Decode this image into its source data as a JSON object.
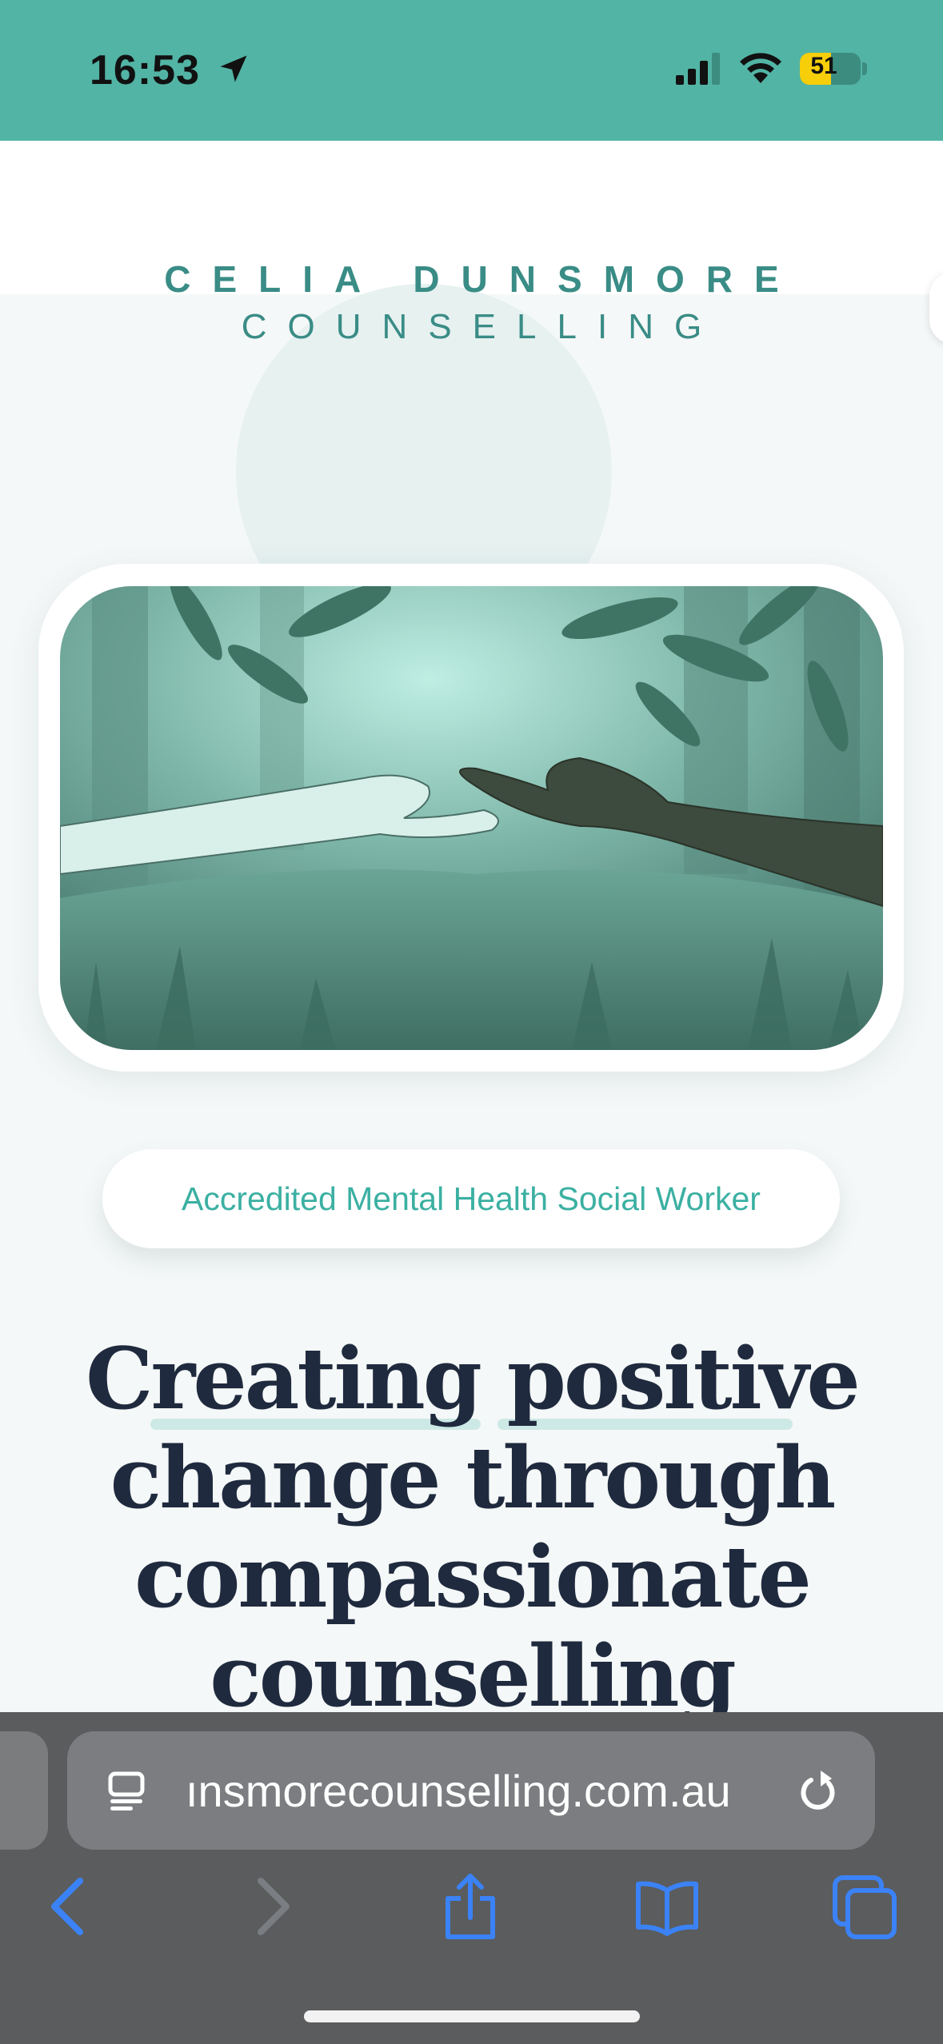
{
  "status_bar": {
    "time": "16:53",
    "battery_level": "51",
    "battery_fraction": 0.51,
    "background_color": "#52b4a5"
  },
  "brand": {
    "line1": "CELIA DUNSMORE",
    "line2": "COUNSELLING",
    "color": "#3a8c86"
  },
  "hero": {
    "image_subject": "illustrated-hands-reaching-forest"
  },
  "credential": {
    "label": "Accredited Mental Health Social Worker"
  },
  "headline": {
    "line1": "Creating positive",
    "line2": "change through",
    "line3": "compassionate",
    "line4": "counselling"
  },
  "browser": {
    "url_display": "ınsmorecounselling.com.au",
    "icons": [
      "reader-icon",
      "reload-icon",
      "back-icon",
      "forward-icon",
      "share-icon",
      "bookmarks-icon",
      "tabs-icon"
    ],
    "accent_color": "#3b82f6"
  }
}
